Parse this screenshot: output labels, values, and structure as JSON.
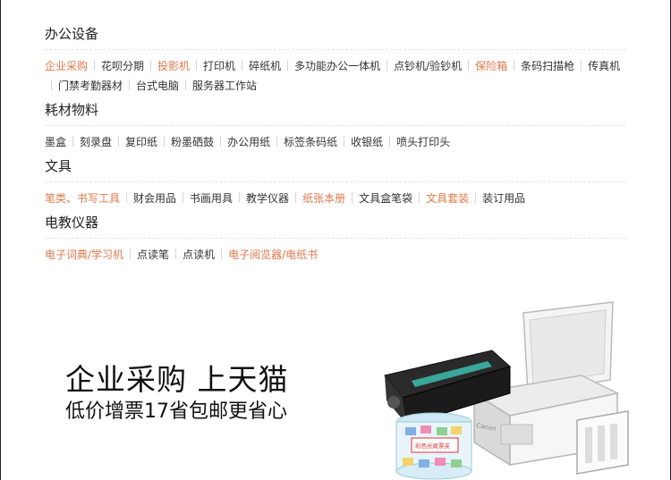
{
  "sections": [
    {
      "title": "办公设备",
      "links": [
        {
          "text": "企业采购",
          "hot": true
        },
        {
          "text": "花呗分期",
          "hot": false
        },
        {
          "text": "投影机",
          "hot": true
        },
        {
          "text": "打印机",
          "hot": false
        },
        {
          "text": "碎纸机",
          "hot": false
        },
        {
          "text": "多功能办公一体机",
          "hot": false
        },
        {
          "text": "点钞机/验钞机",
          "hot": false
        },
        {
          "text": "保险箱",
          "hot": true
        },
        {
          "text": "条码扫描枪",
          "hot": false
        },
        {
          "text": "传真机",
          "hot": false
        },
        {
          "text": "门禁考勤器材",
          "hot": false
        },
        {
          "text": "台式电脑",
          "hot": false
        },
        {
          "text": "服务器工作站",
          "hot": false
        }
      ]
    },
    {
      "title": "耗材物料",
      "links": [
        {
          "text": "墨盒",
          "hot": false
        },
        {
          "text": "刻录盘",
          "hot": false
        },
        {
          "text": "复印纸",
          "hot": false
        },
        {
          "text": "粉墨硒鼓",
          "hot": false
        },
        {
          "text": "办公用纸",
          "hot": false
        },
        {
          "text": "标签条码纸",
          "hot": false
        },
        {
          "text": "收银纸",
          "hot": false
        },
        {
          "text": "喷头打印头",
          "hot": false
        }
      ]
    },
    {
      "title": "文具",
      "links": [
        {
          "text": "笔类、书写工具",
          "hot": true
        },
        {
          "text": "财会用品",
          "hot": false
        },
        {
          "text": "书画用具",
          "hot": false
        },
        {
          "text": "教学仪器",
          "hot": false
        },
        {
          "text": "纸张本册",
          "hot": true
        },
        {
          "text": "文具盒笔袋",
          "hot": false
        },
        {
          "text": "文具套装",
          "hot": true
        },
        {
          "text": "装订用品",
          "hot": false
        }
      ]
    },
    {
      "title": "电教仪器",
      "links": [
        {
          "text": "电子词典/学习机",
          "hot": true
        },
        {
          "text": "点读笔",
          "hot": false
        },
        {
          "text": "点读机",
          "hot": false
        },
        {
          "text": "电子阅览器/电纸书",
          "hot": true
        }
      ]
    }
  ],
  "banner": {
    "headline": "企业采购 上天猫",
    "subline": "低价增票17省包邮更省心",
    "printer_brand": "Canon",
    "jar_label": "彩色长尾票夹"
  },
  "colors": {
    "hot_link": "#e0784a",
    "normal_link": "#333333",
    "title": "#222222",
    "divider": "#e4e4e4"
  }
}
